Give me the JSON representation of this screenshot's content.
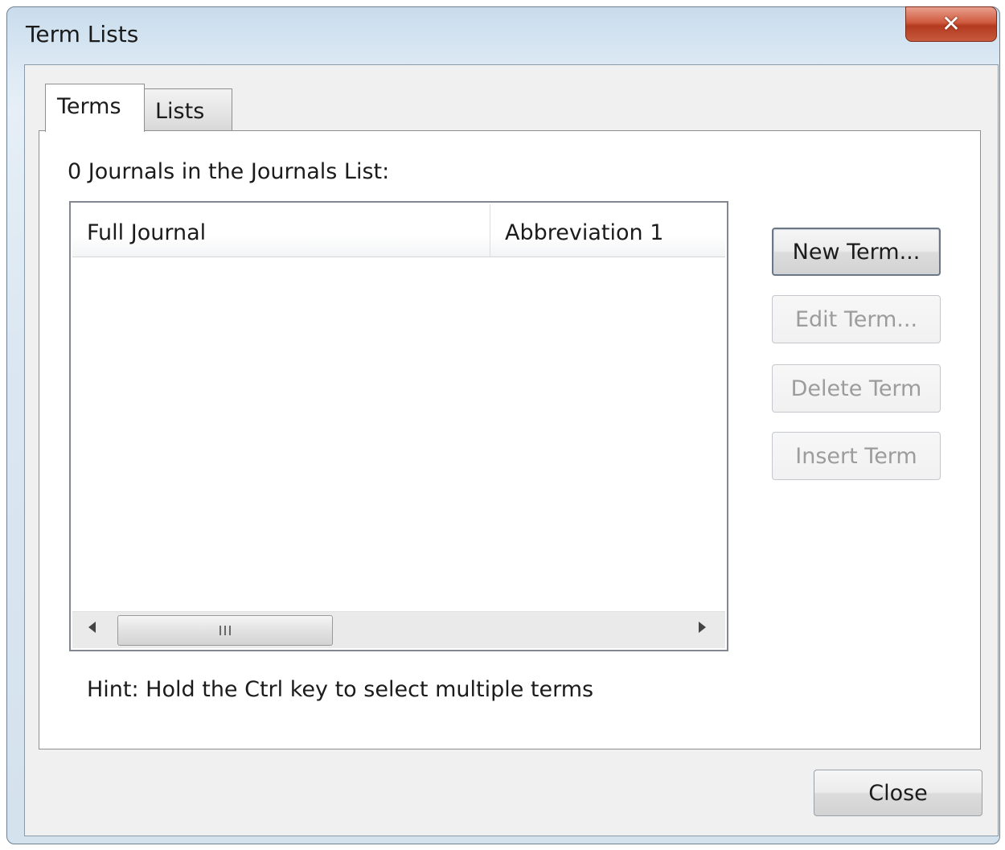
{
  "window": {
    "title": "Term Lists",
    "close_glyph": "✕"
  },
  "tabs": [
    {
      "label": "Terms",
      "selected": true
    },
    {
      "label": "Lists",
      "selected": false
    }
  ],
  "terms_panel": {
    "count_label": "0 Journals in the Journals List:",
    "columns": [
      "Full Journal",
      "Abbreviation 1"
    ],
    "rows": [],
    "hint": "Hint: Hold the Ctrl key to select multiple terms"
  },
  "buttons": {
    "new_term": "New Term...",
    "edit_term": "Edit Term...",
    "delete_term": "Delete Term",
    "insert_term": "Insert Term",
    "close": "Close"
  },
  "icons": {
    "close": "close-icon",
    "scroll_left": "arrow-left-icon",
    "scroll_right": "arrow-right-icon",
    "grip": "scrollbar-grip-icon"
  }
}
